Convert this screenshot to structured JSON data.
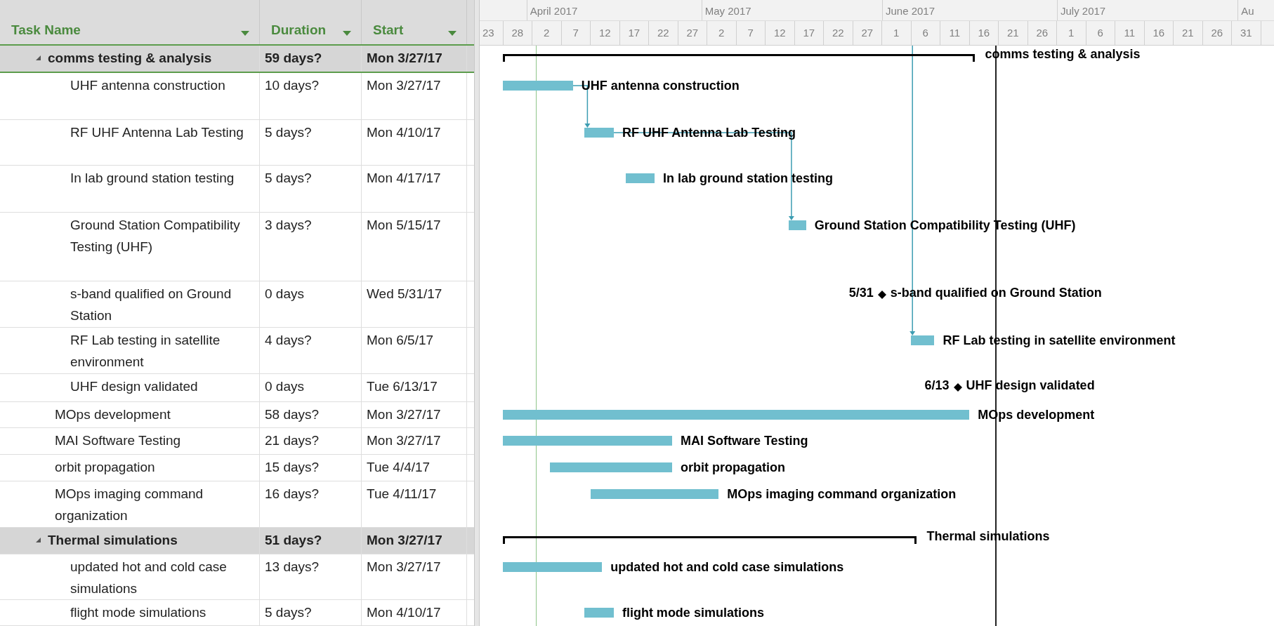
{
  "table": {
    "columns": [
      {
        "label": "Task Name"
      },
      {
        "label": "Duration"
      },
      {
        "label": "Start"
      }
    ],
    "tasks": [
      {
        "name": "comms testing & analysis",
        "duration": "59 days?",
        "start": "Mon 3/27/17",
        "kind": "summary",
        "expanded": true,
        "bar_label": "comms testing & analysis",
        "children": [
          {
            "name": "UHF antenna construction",
            "duration": "10 days?",
            "start": "Mon 3/27/17",
            "kind": "task",
            "bar_label": "UHF antenna construction"
          },
          {
            "name": "RF UHF Antenna Lab Testing",
            "duration": "5 days?",
            "start": "Mon 4/10/17",
            "kind": "task",
            "bar_label": "RF UHF Antenna Lab Testing"
          },
          {
            "name": "In lab ground station testing",
            "duration": "5 days?",
            "start": "Mon 4/17/17",
            "kind": "task",
            "bar_label": "In lab ground station testing"
          },
          {
            "name": "Ground Station Compatibility Testing (UHF)",
            "duration": "3 days?",
            "start": "Mon 5/15/17",
            "kind": "task",
            "bar_label": "Ground Station Compatibility Testing (UHF)"
          },
          {
            "name": "s-band qualified on Ground Station",
            "duration": "0 days",
            "start": "Wed 5/31/17",
            "kind": "milestone",
            "date_label": "5/31",
            "bar_label": "s-band qualified on Ground Station"
          },
          {
            "name": "RF Lab testing in satellite environment",
            "duration": "4 days?",
            "start": "Mon 6/5/17",
            "kind": "task",
            "bar_label": "RF Lab testing in satellite environment"
          },
          {
            "name": "UHF design validated",
            "duration": "0 days",
            "start": "Tue 6/13/17",
            "kind": "milestone",
            "date_label": "6/13",
            "bar_label": "UHF design validated"
          }
        ]
      },
      {
        "name": "MOps development",
        "duration": "58 days?",
        "start": "Mon 3/27/17",
        "kind": "task",
        "bar_label": "MOps development"
      },
      {
        "name": "MAI Software Testing",
        "duration": "21 days?",
        "start": "Mon 3/27/17",
        "kind": "task",
        "bar_label": "MAI Software Testing"
      },
      {
        "name": "orbit propagation",
        "duration": "15 days?",
        "start": "Tue 4/4/17",
        "kind": "task",
        "bar_label": "orbit propagation"
      },
      {
        "name": "MOps imaging command organization",
        "duration": "16 days?",
        "start": "Tue 4/11/17",
        "kind": "task",
        "bar_label": "MOps imaging command organization"
      },
      {
        "name": "Thermal simulations",
        "duration": "51 days?",
        "start": "Mon 3/27/17",
        "kind": "summary",
        "expanded": true,
        "bar_label": "Thermal simulations",
        "children": [
          {
            "name": "updated hot and cold case simulations",
            "duration": "13 days?",
            "start": "Mon 3/27/17",
            "kind": "task",
            "bar_label": "updated hot and cold case simulations"
          },
          {
            "name": "flight mode simulations",
            "duration": "5 days?",
            "start": "Mon 4/10/17",
            "kind": "task",
            "bar_label": "flight mode simulations"
          }
        ]
      }
    ]
  },
  "timescale": {
    "months": [
      "April 2017",
      "May 2017",
      "June 2017",
      "July 2017",
      "Au"
    ],
    "days": [
      "23",
      "28",
      "2",
      "7",
      "12",
      "17",
      "22",
      "27",
      "2",
      "7",
      "12",
      "17",
      "22",
      "27",
      "1",
      "6",
      "11",
      "16",
      "21",
      "26",
      "1",
      "6",
      "11",
      "16",
      "21",
      "26",
      "31"
    ]
  }
}
